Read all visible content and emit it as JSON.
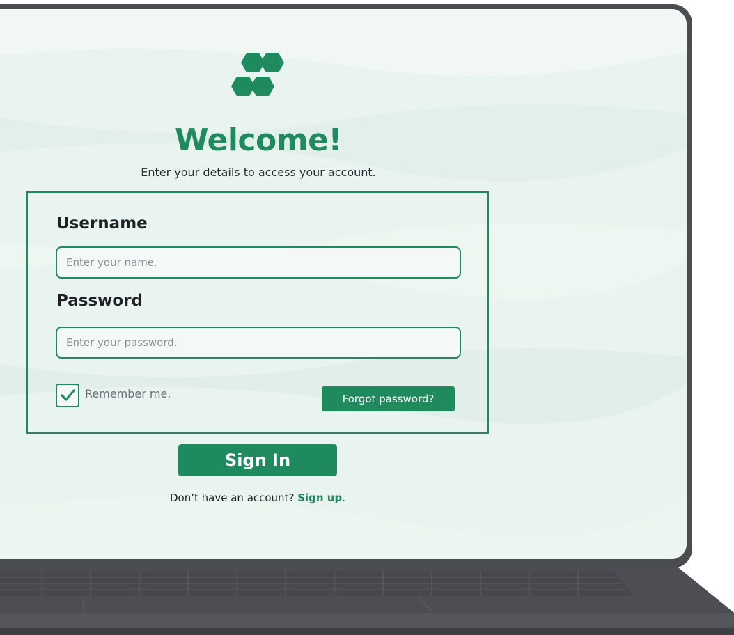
{
  "colors": {
    "accent": "#1f8a5e",
    "screen_background": "#e9f3ef",
    "laptop_frame": "#4a4c50"
  },
  "logo": {
    "icon": "hexagon-cluster-logo-icon"
  },
  "header": {
    "title": "Welcome!",
    "subtitle": "Enter your details to access your account."
  },
  "form": {
    "username": {
      "label": "Username",
      "placeholder": "Enter your name.",
      "value": ""
    },
    "password": {
      "label": "Password",
      "placeholder": "Enter your password.",
      "value": ""
    },
    "remember": {
      "label": "Remember me.",
      "checked": true,
      "icon": "checkmark-icon"
    },
    "forgot_label": "Forgot password?"
  },
  "actions": {
    "signin_label": "Sign In",
    "signup_prompt": "Don’t have an account?",
    "signup_link": "Sign up",
    "signup_suffix": "."
  }
}
